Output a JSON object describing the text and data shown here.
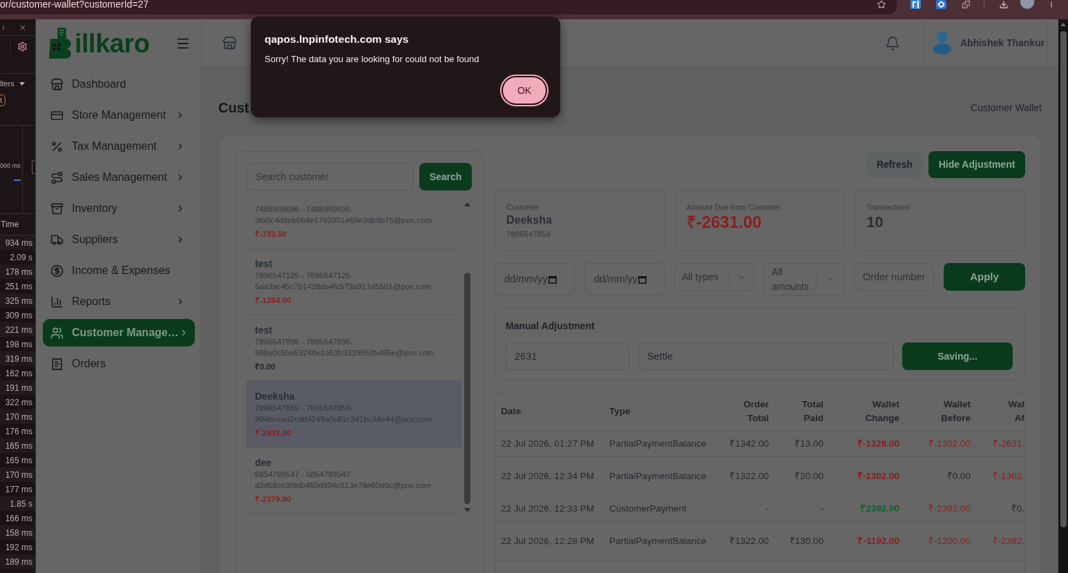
{
  "browser": {
    "url": "or/customer-wallet?customerId=27"
  },
  "devtools": {
    "filter_label": "lters",
    "filter_chip": "t",
    "timeline_label": "000 ms",
    "column": "Time",
    "times": [
      "934 ms",
      "2.09 s",
      "178 ms",
      "251 ms",
      "325 ms",
      "309 ms",
      "221 ms",
      "198 ms",
      "319 ms",
      "162 ms",
      "191 ms",
      "322 ms",
      "170 ms",
      "176 ms",
      "165 ms",
      "165 ms",
      "170 ms",
      "177 ms",
      "1.85 s",
      "166 ms",
      "158 ms",
      "192 ms",
      "189 ms"
    ]
  },
  "sidebar": {
    "logo": "illkaro",
    "items": [
      {
        "label": "Dashboard",
        "submenu": false,
        "selected": false
      },
      {
        "label": "Store Management",
        "submenu": true,
        "selected": false
      },
      {
        "label": "Tax Management",
        "submenu": true,
        "selected": false
      },
      {
        "label": "Sales Management",
        "submenu": true,
        "selected": false
      },
      {
        "label": "Inventory",
        "submenu": true,
        "selected": false
      },
      {
        "label": "Suppliers",
        "submenu": true,
        "selected": false
      },
      {
        "label": "Income & Expenses",
        "submenu": false,
        "selected": false
      },
      {
        "label": "Reports",
        "submenu": true,
        "selected": false
      },
      {
        "label": "Customer Manage…",
        "submenu": true,
        "selected": true
      },
      {
        "label": "Orders",
        "submenu": false,
        "selected": false
      }
    ]
  },
  "header": {
    "user_name": "Abhishek Thankur"
  },
  "page": {
    "title": "Cust",
    "breadcrumb": "Customer Wallet"
  },
  "customer_list": {
    "search": {
      "placeholder": "Search customer"
    },
    "search_button": "Search",
    "items": [
      {
        "contact": [
          "7485969696 - 7485969696-",
          "3fa0c4d8eb664e1792051e69e3db9b75@pos.com"
        ],
        "balance": "₹-733.50",
        "negative": true,
        "selected": false
      },
      {
        "name": "test",
        "contact": [
          "7896547125 - 7896547125-",
          "5aa3ac45c7b1428da4fc579a917d5501@pos.com"
        ],
        "balance": "₹-1264.00",
        "negative": true,
        "selected": false
      },
      {
        "name": "test",
        "contact": [
          "7896547896 - 7896547896-",
          "999a0c5be53240e1a53b3339952b495e@pos.com"
        ],
        "balance": "₹0.00",
        "negative": false,
        "selected": false
      },
      {
        "name": "Deeksha",
        "contact": [
          "7896547859 - 7896547859-",
          "994bcead2cdd4249a0c81c3d1bc34e44@pos.com"
        ],
        "balance": "₹-2631.00",
        "negative": true,
        "selected": true
      },
      {
        "name": "dee",
        "contact": [
          "6854789547 - 6854789547-",
          "d2d68cb3f9db460d994c513e78e60d9c@pos.com"
        ],
        "balance": "₹-2379.00",
        "negative": true,
        "selected": false
      }
    ]
  },
  "actions": [
    {
      "label": "Refresh",
      "kind": "secondary"
    },
    {
      "label": "Hide Adjustment",
      "kind": "primary"
    }
  ],
  "summary": [
    {
      "label": "Customer",
      "value": "Deeksha",
      "detail": "7896547859",
      "negative": false
    },
    {
      "label": "Amount Due from Customer",
      "value": "₹-2631.00",
      "negative": true
    },
    {
      "label": "Transactions",
      "value": "10",
      "negative": false
    }
  ],
  "filters": {
    "date_from": {
      "placeholder": "dd/mm/yy"
    },
    "date_to": {
      "placeholder": "dd/mm/yy"
    },
    "type": {
      "value": "All types"
    },
    "amount": {
      "value": "All amounts"
    },
    "order": {
      "placeholder": "Order number"
    },
    "apply": "Apply"
  },
  "adjustment": {
    "title": "Manual Adjustment",
    "amount": {
      "value": "2631"
    },
    "note": {
      "value": "Settle"
    },
    "button": "Saving..."
  },
  "transactions": {
    "columns": [
      "Date",
      "Type",
      "Order Total",
      "Total Paid",
      "Wallet Change",
      "Wallet Before",
      "Wal Af"
    ],
    "rows": [
      {
        "date": "22 Jul 2026, 01:27 PM",
        "type": "PartialPaymentBalance",
        "order_total": "₹1342.00",
        "total_paid": "₹13.00",
        "wallet_change": {
          "text": "₹-1329.00",
          "negative": true
        },
        "wallet_before": {
          "text": "₹-1302.00",
          "negative": true
        },
        "column_7": {
          "text": "₹-2631.",
          "negative": true
        }
      },
      {
        "date": "22 Jul 2026, 12:34 PM",
        "type": "PartialPaymentBalance",
        "order_total": "₹1322.00",
        "total_paid": "₹20.00",
        "wallet_change": {
          "text": "₹-1302.00",
          "negative": true
        },
        "wallet_before": {
          "text": "₹0.00",
          "negative": false
        },
        "column_7": {
          "text": "₹-1302.",
          "negative": true
        }
      },
      {
        "date": "22 Jul 2026, 12:33 PM",
        "type": "CustomerPayment",
        "order_total": "-",
        "total_paid": "-",
        "wallet_change": {
          "text": "₹2392.00",
          "negative": false
        },
        "wallet_before": {
          "text": "₹-2392.00",
          "negative": true
        },
        "column_7": {
          "text": "₹0.",
          "negative": false
        }
      },
      {
        "date": "22 Jul 2026, 12:28 PM",
        "type": "PartialPaymentBalance",
        "order_total": "₹1322.00",
        "total_paid": "₹130.00",
        "wallet_change": {
          "text": "₹-1192.00",
          "negative": true
        },
        "wallet_before": {
          "text": "₹-1200.00",
          "negative": true
        },
        "column_7": {
          "text": "₹-2392.",
          "negative": true
        }
      }
    ]
  },
  "dialog": {
    "title": "qapos.lnpinfotech.com says",
    "message": "Sorry! The data you are looking for could not be found",
    "button": "OK"
  }
}
